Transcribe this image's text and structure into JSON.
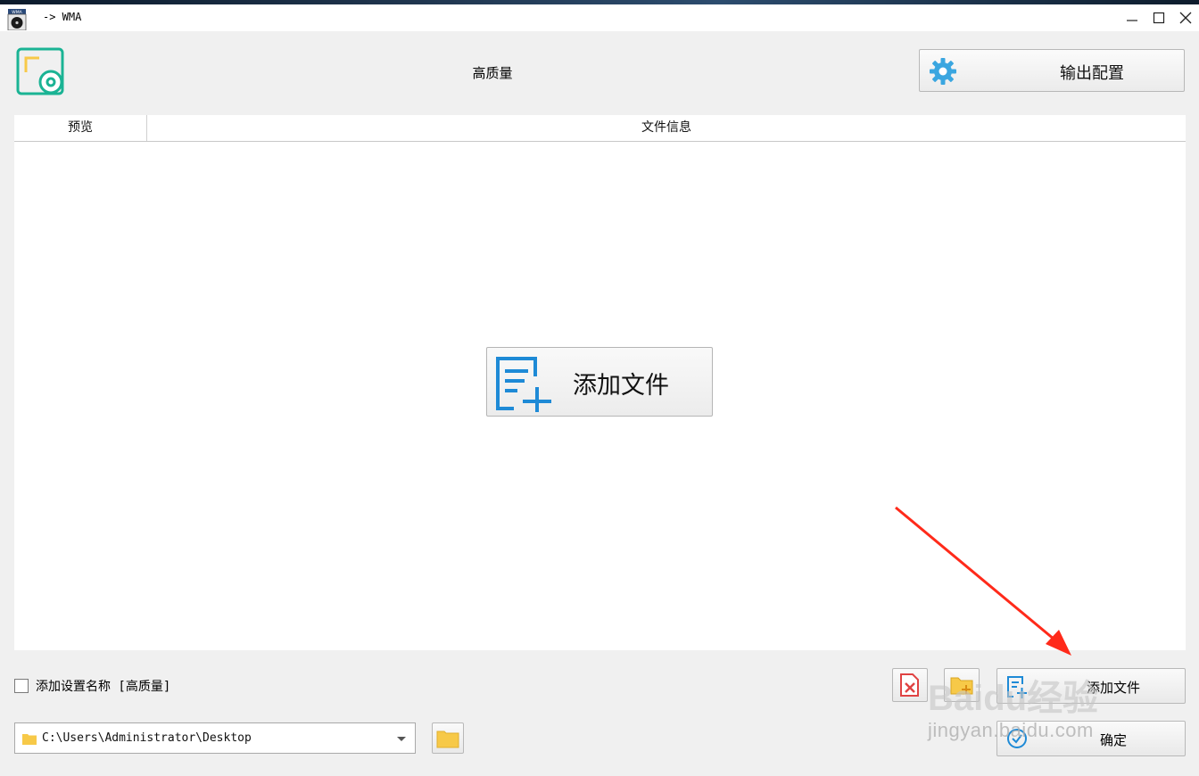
{
  "window": {
    "title": "-> WMA",
    "app_icon_badge": "WMA"
  },
  "header": {
    "profile_title": "高质量",
    "output_button_label": "输出配置"
  },
  "table": {
    "columns": [
      "预览",
      "文件信息"
    ]
  },
  "center_button": {
    "label": "添加文件"
  },
  "footer": {
    "checkbox_label": "添加设置名称 [高质量]",
    "checkbox_checked": false,
    "add_file_label": "添加文件",
    "confirm_label": "确定",
    "output_path": "C:\\Users\\Administrator\\Desktop"
  },
  "watermark": {
    "brand": "Baidu经验",
    "url": "jingyan.baidu.com"
  },
  "colors": {
    "accent_teal": "#1ab394",
    "accent_blue": "#1e8ad6",
    "gear_blue": "#3aa6e0",
    "folder_yellow": "#f7c948",
    "delete_red": "#e04343",
    "annotation_red": "#ff2a1a"
  }
}
